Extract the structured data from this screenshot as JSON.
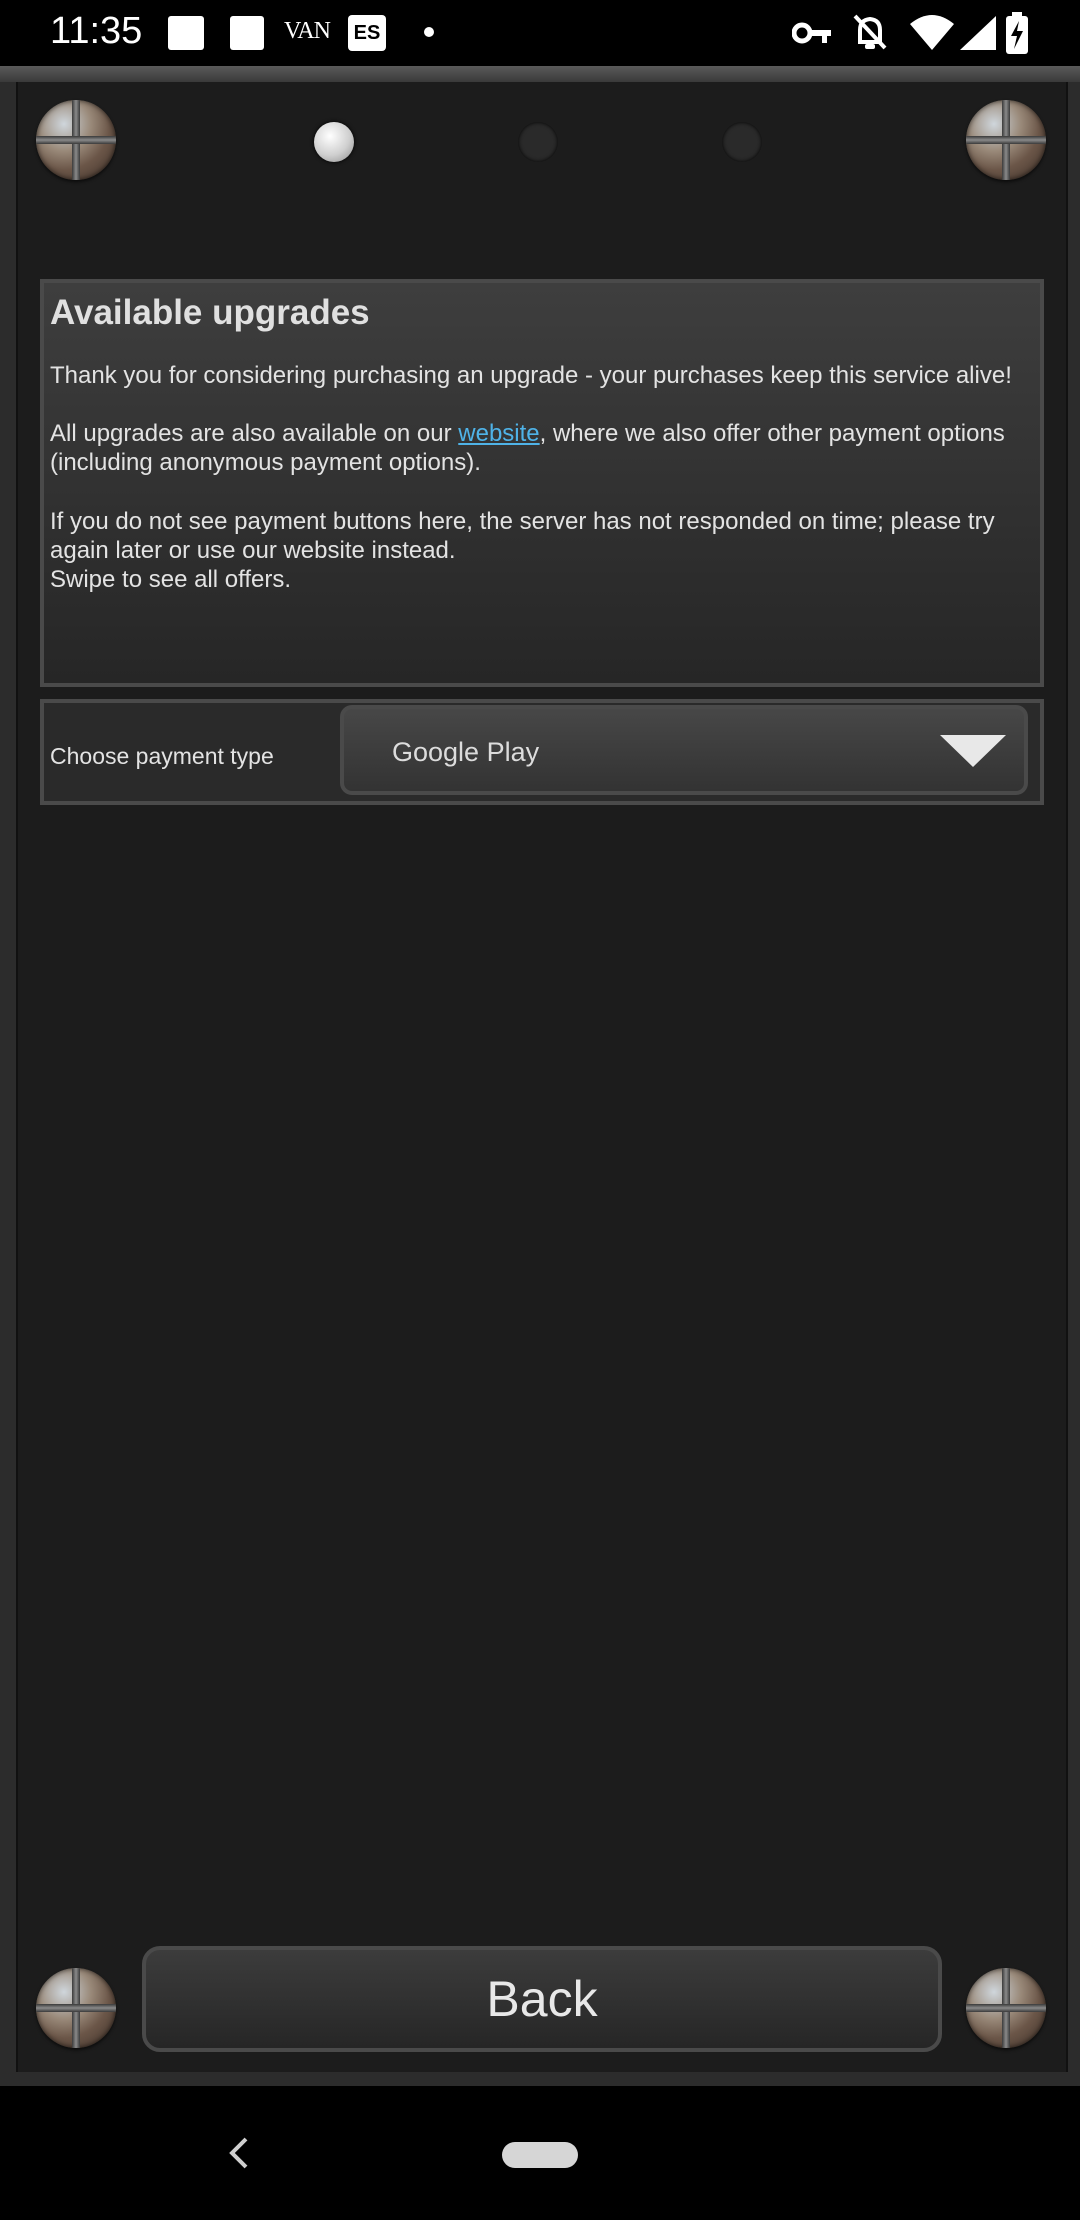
{
  "status_bar": {
    "time": "11:35",
    "notifications": [
      "square-icon",
      "square-icon",
      "VAN",
      "ES",
      "dot-icon"
    ],
    "notif_van": "VAN",
    "notif_es": "ES",
    "system_icons": [
      "key-icon",
      "bell-off-icon",
      "wifi-icon",
      "battery-charging-icon"
    ]
  },
  "pager": {
    "page_count": 3,
    "active_page": 1
  },
  "upgrades": {
    "title": "Available upgrades",
    "p1": "Thank you for considering purchasing an upgrade - your purchases keep this service alive!",
    "p2_before": "All upgrades are also available on our ",
    "p2_link": "website",
    "p2_after": ", where we also offer other payment options (including anonymous payment options).",
    "p3": "If you do not see payment buttons here, the server has not responded on time; please try again later or use our website instead.",
    "p4": "Swipe to see all offers."
  },
  "payment": {
    "label": "Choose payment type",
    "selected": "Google Play"
  },
  "back_button": {
    "label": "Back"
  },
  "colors": {
    "background": "#1c1c1c",
    "panel_border": "#4a4a4a",
    "link": "#4fb3e8",
    "text": "#e3e3e3"
  },
  "nav_bar": {
    "back_icon": "chevron-left-icon",
    "home_icon": "home-pill-icon"
  }
}
